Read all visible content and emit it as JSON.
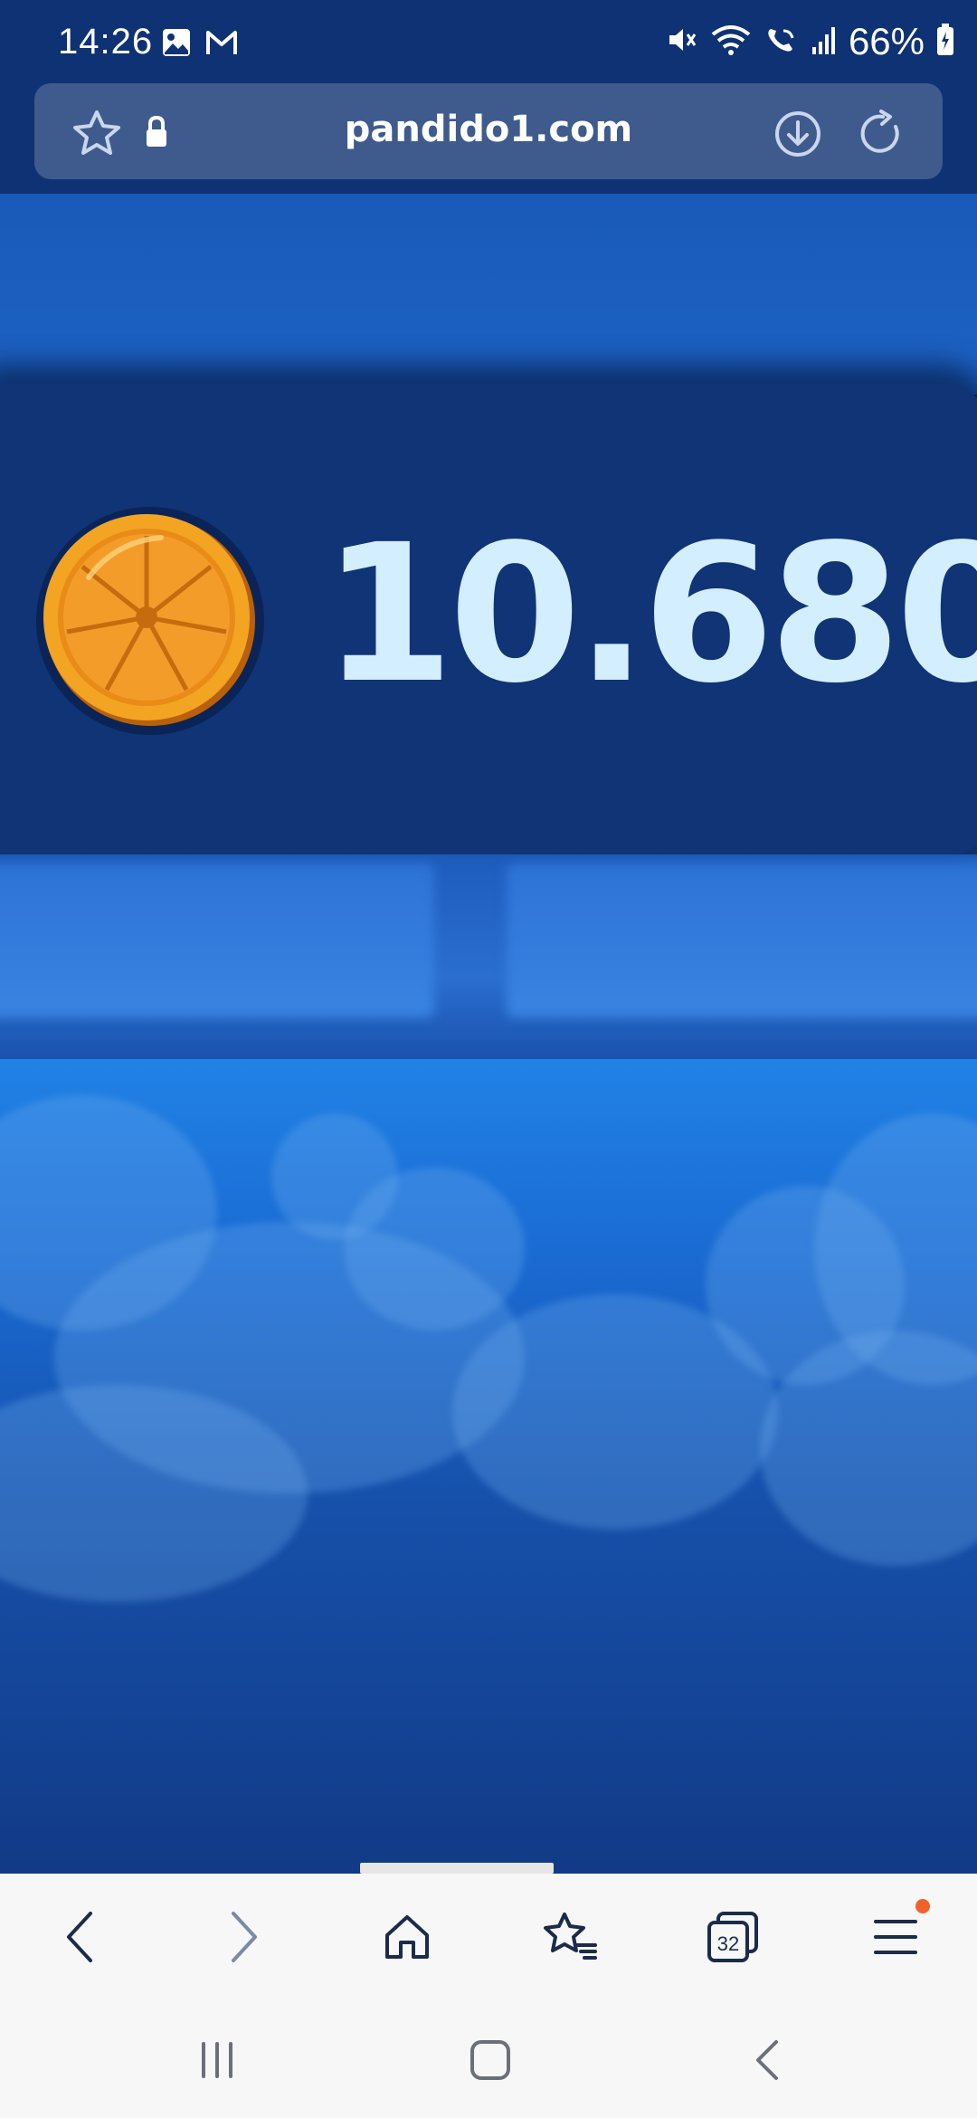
{
  "status_bar": {
    "time": "14:26",
    "left_icons": [
      "image-icon",
      "gmail-icon"
    ],
    "right_icons": [
      "mute-icon",
      "wifi-icon",
      "wifi-calling-icon",
      "signal-icon",
      "battery-icon"
    ],
    "battery_percent": "66%"
  },
  "browser": {
    "url": "pandido1.com",
    "tab_count": "32",
    "accent_color": "#f0622a"
  },
  "game": {
    "balance": "10.680",
    "coin_icon": "orange-coin-icon",
    "balance_color": "#d3eeff"
  },
  "bottom_nav": {
    "items": [
      "back-icon",
      "forward-icon",
      "home-icon",
      "bookmarks-icon",
      "tabs-icon",
      "menu-icon"
    ]
  },
  "system_nav": {
    "items": [
      "recent-apps-icon",
      "home-button-icon",
      "system-back-icon"
    ]
  }
}
